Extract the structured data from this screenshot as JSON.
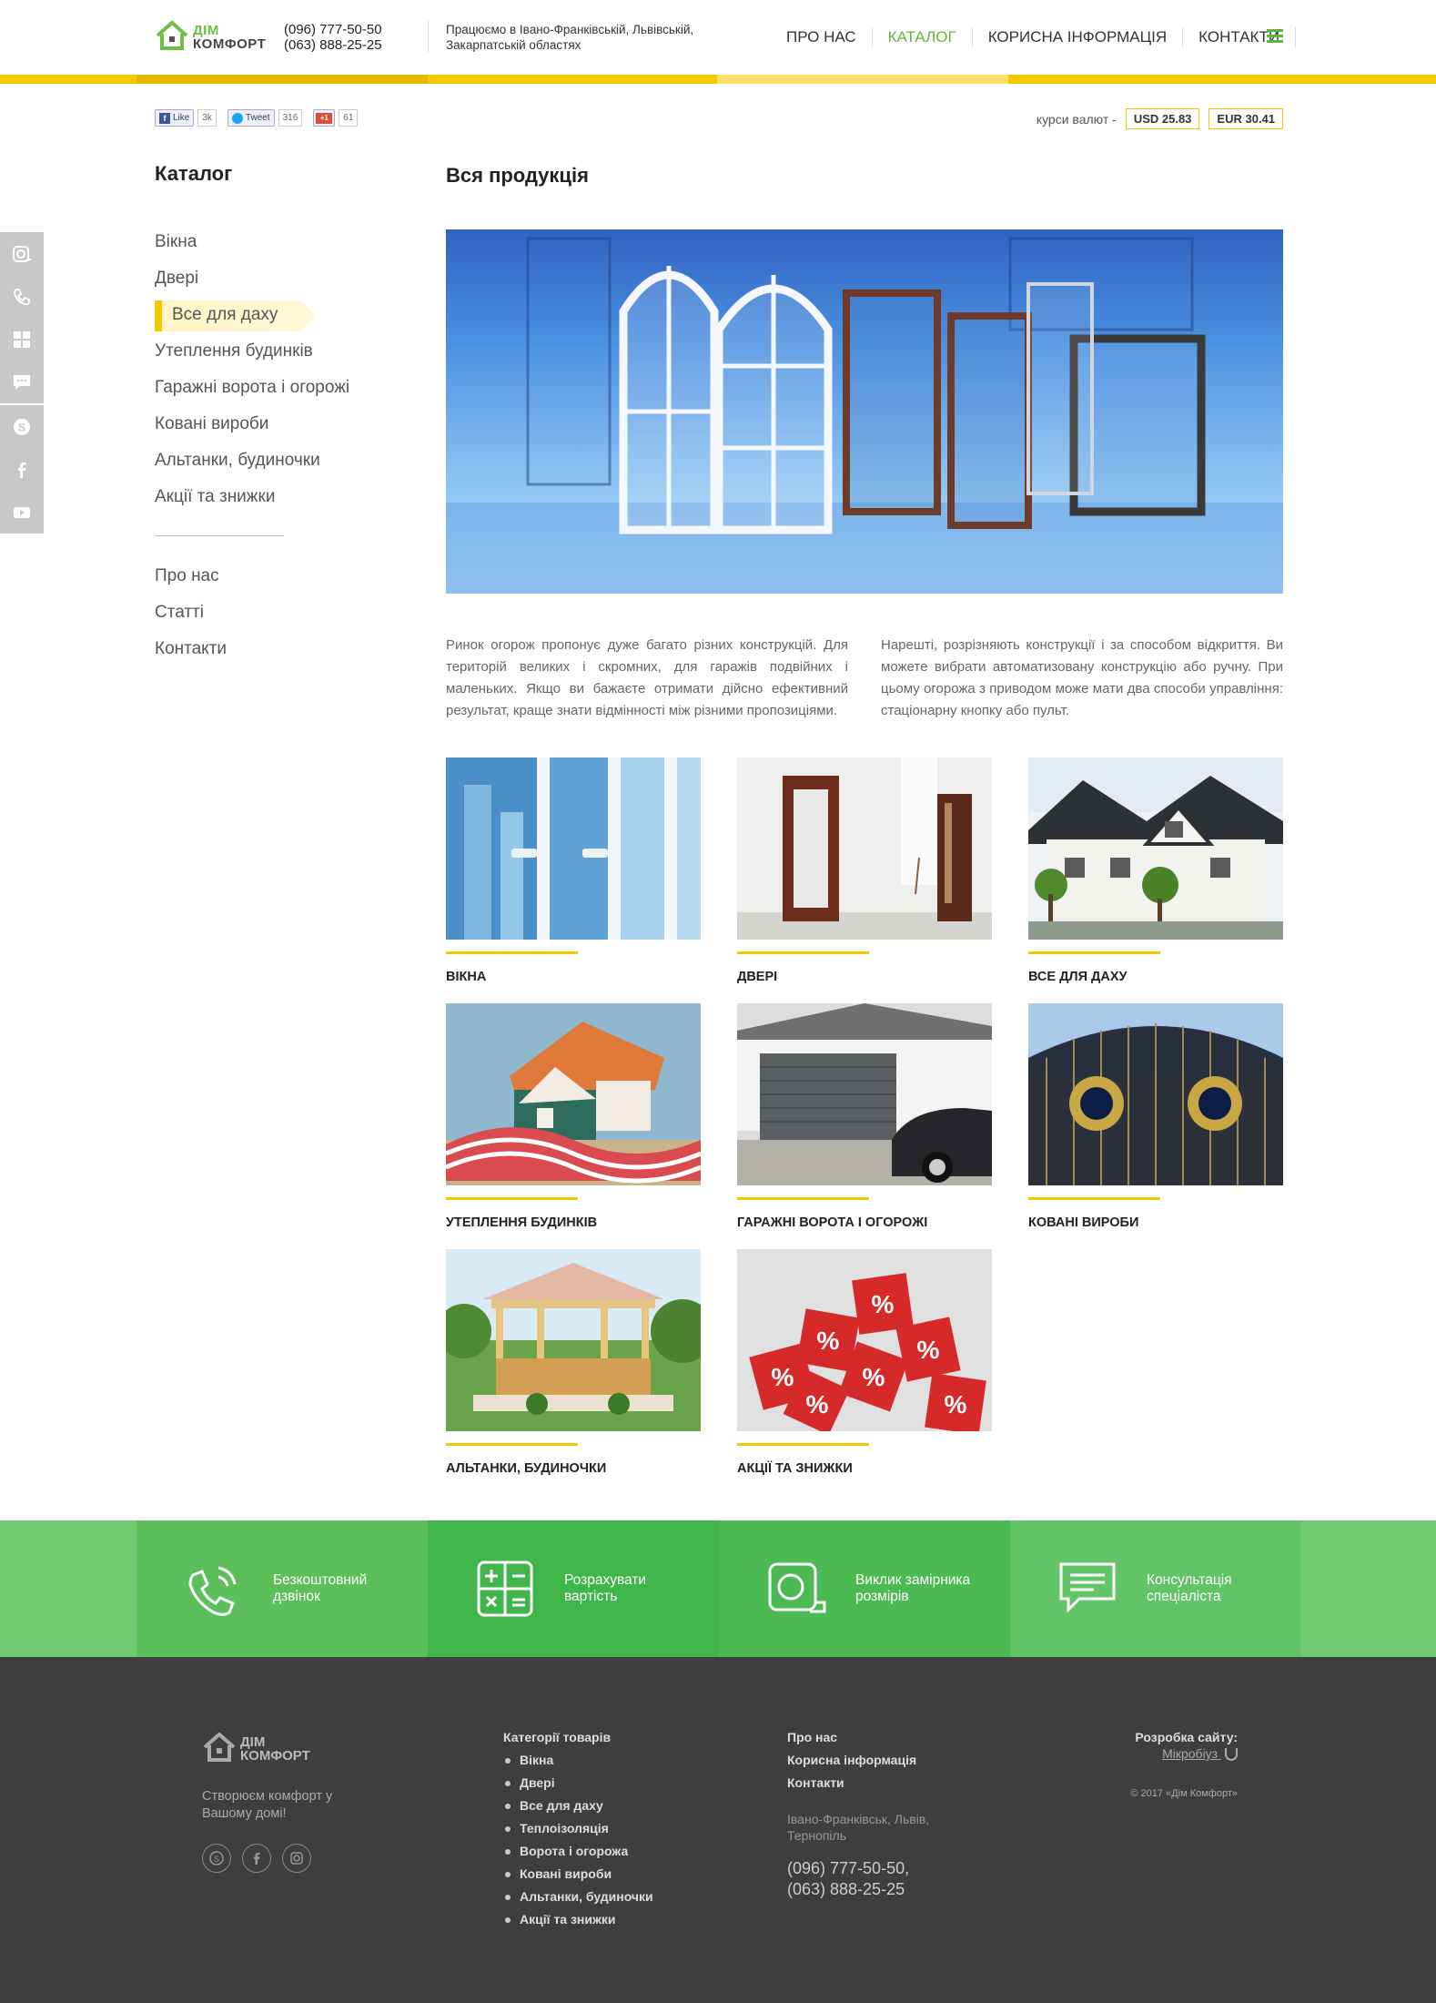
{
  "header": {
    "logo_line1": "ДІМ",
    "logo_line2": "КОМФОРТ",
    "phone1": "(096) 777-50-50",
    "phone2": "(063) 888-25-25",
    "regions_line1": "Працюємо в Івано-Франківській, Львівській,",
    "regions_line2": "Закарпатській областях",
    "nav": [
      "ПРО НАС",
      "КАТАЛОГ",
      "КОРИСНА ІНФОРМАЦІЯ",
      "КОНТАКТИ"
    ],
    "active_nav": "КАТАЛОГ",
    "topbar_colors": [
      "#f5c800",
      "#e8b800",
      "#ffd43b",
      "#ffe27a",
      "#f5c800"
    ]
  },
  "share": {
    "fb_label": "Like",
    "fb_count": "3k",
    "tw_label": "Tweet",
    "tw_count": "316",
    "gp_label": "+1",
    "gp_count": "61"
  },
  "currency": {
    "label": "курси валют -",
    "usd": "USD 25.83",
    "eur": "EUR 30.41"
  },
  "sidebar": {
    "title": "Каталог",
    "items": [
      "Вікна",
      "Двері",
      "Все для даху",
      "Утеплення будинків",
      "Гаражні ворота і огорожі",
      "Ковані вироби",
      "Альтанки, будиночки",
      "Акції та знижки"
    ],
    "active_item": "Все для даху",
    "links": [
      "Про нас",
      "Статті",
      "Контакти"
    ]
  },
  "main": {
    "title": "Вся продукція",
    "text_left": "Ринок огорож пропонує дуже багато різних конструкцій. Для територій великих і скромних, для гаражів подвійних і маленьких. Якщо ви бажаєте отримати дійсно ефективний результат, краще знати відмінності між різними пропозиціями.",
    "text_right": "Нарешті, розрізняють конструкції і за способом відкриття. Ви можете вибрати автоматизовану конструкцію або ручну. При цьому огорожа з приводом може мати два способи управління: стаціонарну кнопку або пульт.",
    "products": [
      "ВІКНА",
      "ДВЕРІ",
      "ВСЕ ДЛЯ ДАХУ",
      "УТЕПЛЕННЯ БУДИНКІВ",
      "ГАРАЖНІ ВОРОТА І ОГОРОЖІ",
      "КОВАНІ ВИРОБИ",
      "АЛЬТАНКИ, БУДИНОЧКИ",
      "АКЦІЇ ТА ЗНИЖКИ"
    ]
  },
  "services": [
    {
      "line1": "Безкоштовний",
      "line2": "дзвінок",
      "color": "#5cbf5c"
    },
    {
      "line1": "Розрахувати",
      "line2": "вартість",
      "color": "#3fb54b"
    },
    {
      "line1": "Виклик замірника",
      "line2": "розмірів",
      "color": "#4cba52"
    },
    {
      "line1": "Консультація",
      "line2": "спеціаліста",
      "color": "#62c466"
    }
  ],
  "footer": {
    "logo_line1": "ДІМ",
    "logo_line2": "КОМФОРТ",
    "slogan": "Створюєм комфорт у Вашому домі!",
    "categories_title": "Категорії товарів",
    "categories": [
      "Вікна",
      "Двері",
      "Все для даху",
      "Теплоізоляція",
      "Ворота і огорожа",
      "Ковані вироби",
      "Альтанки, будиночки",
      "Акції та знижки"
    ],
    "links": [
      "Про нас",
      "Корисна інформація",
      "Контакти"
    ],
    "address_line1": "Івано-Франківськ, Львів,",
    "address_line2": "Тернопіль",
    "phone1": "(096) 777-50-50,",
    "phone2": "(063) 888-25-25",
    "dev_label": "Розробка сайту:",
    "dev_name": "Мікробіуз",
    "copyright": "© 2017 «Дім Комфорт»"
  }
}
